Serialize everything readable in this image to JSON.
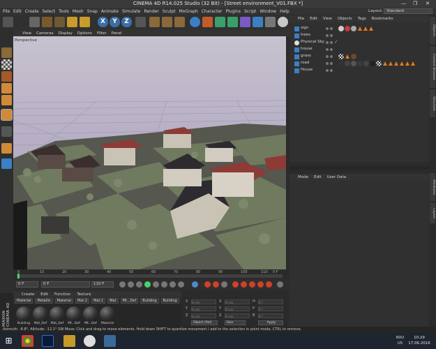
{
  "window": {
    "title": "CINEMA 4D R14.025 Studio (32 Bit) - [Street environment_V01.FBX *]",
    "minimize": "—",
    "maximize": "❐",
    "close": "✕"
  },
  "menu": [
    "File",
    "Edit",
    "Create",
    "Select",
    "Tools",
    "Mesh",
    "Snap",
    "Animate",
    "Simulate",
    "Render",
    "Sculpt",
    "MoGraph",
    "Character",
    "Plugins",
    "Script",
    "Window",
    "Help"
  ],
  "layout": {
    "label": "Layout:",
    "value": "Standard"
  },
  "toolbar": {
    "x_label": "X",
    "y_label": "Y",
    "z_label": "Z"
  },
  "viewport": {
    "menu": [
      "View",
      "Cameras",
      "Display",
      "Options",
      "Filter",
      "Panel"
    ],
    "label": "Perspective"
  },
  "timeline": {
    "ticks": [
      "0",
      "10",
      "20",
      "30",
      "40",
      "50",
      "60",
      "70",
      "80",
      "90",
      "100",
      "110"
    ],
    "end": "0 F"
  },
  "transport": {
    "start": "0 F",
    "current": "0 F",
    "end": "110 F",
    "max": "110 F"
  },
  "material_manager": {
    "menu": [
      "Create",
      "Edit",
      "Function",
      "Texture"
    ],
    "filters": [
      "Material",
      "Metallic",
      "Material",
      "Mat.2",
      "Mat.1",
      "Mat",
      "Mt...Def",
      "Building",
      "Building"
    ],
    "materials": [
      "Building",
      "Mat_Def",
      "Mat_Def",
      "Mt...Def",
      "Mt...Def",
      "Material"
    ]
  },
  "coordinates": {
    "rows": [
      {
        "a": "X",
        "av": "0 cm",
        "b": "X",
        "bv": "0 cm",
        "c": "H",
        "cv": "0 °"
      },
      {
        "a": "Y",
        "av": "0 cm",
        "b": "Y",
        "bv": "0 cm",
        "c": "P",
        "cv": "0 °"
      },
      {
        "a": "Z",
        "av": "0 cm",
        "b": "Z",
        "bv": "0 cm",
        "c": "B",
        "cv": "0 °"
      }
    ],
    "mode": "Object (Rel)",
    "size_mode": "Size",
    "apply": "Apply"
  },
  "status": "Azimuth: -8.8°, Altitude: -12.1° SW   Move: Click and drag to move elements. Hold down SHIFT to quantize movement / add to the selection in point mode, CTRL to remove.",
  "object_manager": {
    "menu": [
      "File",
      "Edit",
      "View",
      "Objects",
      "Tags",
      "Bookmarks"
    ],
    "objects": [
      "sign",
      "trees",
      "Physical Sky",
      "house",
      "grass",
      "road",
      "House"
    ]
  },
  "attribute_manager": {
    "menu": [
      "Mode",
      "Edit",
      "User Data"
    ]
  },
  "right_tabs": [
    "Objects",
    "Content Browser",
    "Structure",
    "Attributes",
    "Layers"
  ],
  "brand": "MAXON CINEMA 4D",
  "taskbar": {
    "lang_top": "ROU",
    "lang_bottom": "US",
    "time": "10:29",
    "date": "17.06.2016"
  },
  "colors": {
    "accent": "#3b6ea8",
    "orange": "#e07a1e",
    "sky": "#c7c2ce"
  }
}
